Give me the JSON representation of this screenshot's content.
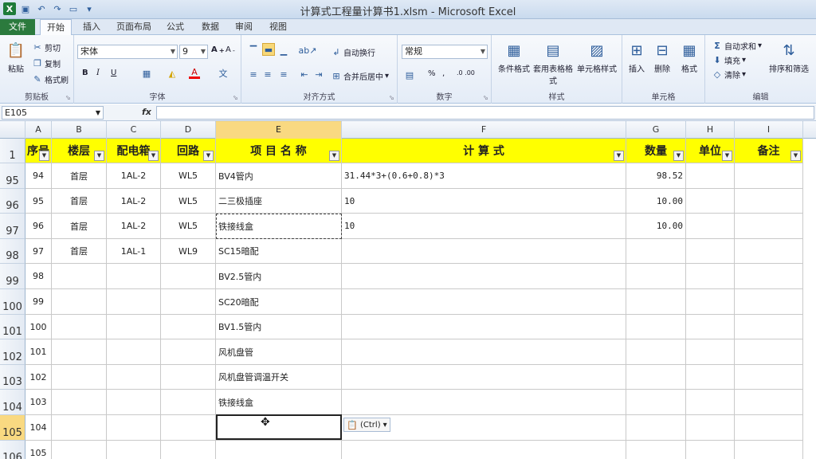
{
  "window": {
    "title": "计算式工程量计算书1.xlsm - Microsoft Excel",
    "app_logo": "X"
  },
  "tabs": [
    "文件",
    "开始",
    "插入",
    "页面布局",
    "公式",
    "数据",
    "审阅",
    "视图"
  ],
  "ribbon": {
    "clipboard": {
      "paste": "粘贴",
      "cut": "剪切",
      "copy": "复制",
      "format_painter": "格式刷",
      "label": "剪贴板"
    },
    "font": {
      "name": "宋体",
      "size": "9",
      "label": "字体",
      "bold": "B",
      "italic": "I",
      "underline": "U"
    },
    "alignment": {
      "wrap": "自动换行",
      "merge": "合并后居中",
      "label": "对齐方式"
    },
    "number": {
      "format": "常规",
      "label": "数字",
      "percent": "%",
      "comma": ","
    },
    "styles": {
      "conditional": "条件格式",
      "table": "套用表格格式",
      "cell_styles": "单元格样式",
      "label": "样式"
    },
    "cells": {
      "insert": "插入",
      "delete": "删除",
      "format": "格式",
      "label": "单元格"
    },
    "editing": {
      "autosum": "自动求和",
      "fill": "填充",
      "clear": "清除",
      "sort": "排序和筛选",
      "label": "编辑"
    }
  },
  "formula_bar": {
    "name_box": "E105",
    "fx": "fx",
    "content": ""
  },
  "columns": [
    "A",
    "B",
    "C",
    "D",
    "E",
    "F",
    "G",
    "H",
    "I"
  ],
  "header_row": {
    "row_num": "1",
    "cells": [
      "序号",
      "楼层",
      "配电箱",
      "回路",
      "项 目 名 称",
      "计 算 式",
      "数量",
      "单位",
      "备注"
    ]
  },
  "rows": [
    {
      "num": "95",
      "cells": [
        "94",
        "首层",
        "1AL-2",
        "WL5",
        "BV4管内",
        "31.44*3+(0.6+0.8)*3",
        "98.52",
        "",
        ""
      ]
    },
    {
      "num": "96",
      "cells": [
        "95",
        "首层",
        "1AL-2",
        "WL5",
        "二三极插座",
        "10",
        "10.00",
        "",
        ""
      ]
    },
    {
      "num": "97",
      "cells": [
        "96",
        "首层",
        "1AL-2",
        "WL5",
        "铁接线盒",
        "10",
        "10.00",
        "",
        ""
      ]
    },
    {
      "num": "98",
      "cells": [
        "97",
        "首层",
        "1AL-1",
        "WL9",
        "SC15暗配",
        "",
        "",
        "",
        ""
      ]
    },
    {
      "num": "99",
      "cells": [
        "98",
        "",
        "",
        "",
        "BV2.5管内",
        "",
        "",
        "",
        ""
      ]
    },
    {
      "num": "100",
      "cells": [
        "99",
        "",
        "",
        "",
        "SC20暗配",
        "",
        "",
        "",
        ""
      ]
    },
    {
      "num": "101",
      "cells": [
        "100",
        "",
        "",
        "",
        "BV1.5管内",
        "",
        "",
        "",
        ""
      ]
    },
    {
      "num": "102",
      "cells": [
        "101",
        "",
        "",
        "",
        "风机盘管",
        "",
        "",
        "",
        ""
      ]
    },
    {
      "num": "103",
      "cells": [
        "102",
        "",
        "",
        "",
        "风机盘管调温开关",
        "",
        "",
        "",
        ""
      ]
    },
    {
      "num": "104",
      "cells": [
        "103",
        "",
        "",
        "",
        "铁接线盒",
        "",
        "",
        "",
        ""
      ]
    },
    {
      "num": "105",
      "cells": [
        "104",
        "",
        "",
        "",
        "",
        "",
        "",
        "",
        ""
      ]
    },
    {
      "num": "106",
      "cells": [
        "105",
        "",
        "",
        "",
        "",
        "",
        "",
        "",
        ""
      ]
    }
  ],
  "paste_options": "(Ctrl)",
  "colors": {
    "header_fill": "#ffff00",
    "selection_header": "#f9d981",
    "file_tab": "#2b7a3d"
  }
}
